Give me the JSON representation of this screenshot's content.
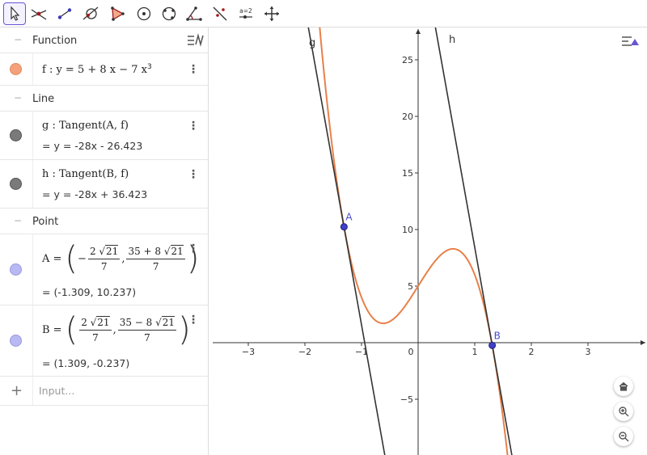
{
  "toolbar": {
    "tools": [
      {
        "name": "move-tool-icon",
        "active": true
      },
      {
        "name": "function-inspector-icon"
      },
      {
        "name": "point-line-icon"
      },
      {
        "name": "circle-through-points-icon"
      },
      {
        "name": "polygon-icon"
      },
      {
        "name": "circle-center-point-icon"
      },
      {
        "name": "conic-through-points-icon"
      },
      {
        "name": "angle-icon"
      },
      {
        "name": "reflect-about-line-icon"
      },
      {
        "name": "slider-icon",
        "label": "a=2"
      },
      {
        "name": "move-graphics-view-icon"
      }
    ]
  },
  "algebra": {
    "groups": {
      "function": "Function",
      "line": "Line",
      "point": "Point"
    },
    "f": {
      "definition": "f : y = 5 + 8 x − 7 x",
      "exponent": "3",
      "color": "#f4a27c"
    },
    "g": {
      "definition": "g : Tangent(A, f)",
      "value": "= y = -28x - 26.423",
      "color": "#707070"
    },
    "h": {
      "definition": "h : Tangent(B, f)",
      "value": "= y = -28x + 36.423",
      "color": "#707070"
    },
    "A": {
      "label": "A =",
      "x_num_sign": "−",
      "x_num_coef": "2",
      "x_num_rad": "21",
      "x_den": "7",
      "y_num_prefix": "35 + 8",
      "y_num_rad": "21",
      "y_den": "7",
      "value": "= (-1.309, 10.237)",
      "color": "#b8b8f3"
    },
    "B": {
      "label": "B =",
      "x_num_coef": "2",
      "x_num_rad": "21",
      "x_den": "7",
      "y_num_prefix": "35 − 8",
      "y_num_rad": "21",
      "y_den": "7",
      "value": "= (1.309, -0.237)",
      "color": "#b8b8f3"
    },
    "input_placeholder": "Input..."
  },
  "graphics": {
    "x_ticks": [
      "−3",
      "−2",
      "−1",
      "0",
      "1",
      "2",
      "3"
    ],
    "y_ticks": [
      "25",
      "20",
      "15",
      "10",
      "5",
      "−5"
    ],
    "labels": {
      "g": "g",
      "h": "h",
      "A": "A",
      "B": "B"
    },
    "colors": {
      "f": "#e8804a",
      "tangent": "#333333",
      "point": "#4040c8",
      "point_label": "#4a4ad0"
    }
  },
  "chart_data": {
    "type": "line",
    "xlim": [
      -3.8,
      3.8
    ],
    "ylim": [
      -9.8,
      27.5
    ],
    "series": [
      {
        "name": "f",
        "expression": "5 + 8x - 7x^3"
      },
      {
        "name": "g",
        "expression": "-28x - 26.423"
      },
      {
        "name": "h",
        "expression": "-28x + 36.423"
      }
    ],
    "points": [
      {
        "name": "A",
        "x": -1.309,
        "y": 10.237
      },
      {
        "name": "B",
        "x": 1.309,
        "y": -0.237
      }
    ]
  }
}
